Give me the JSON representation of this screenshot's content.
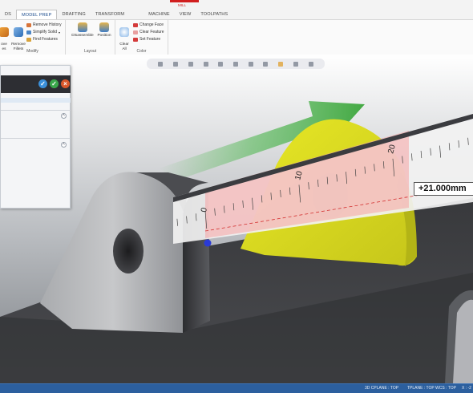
{
  "ribbon": {
    "tabs": [
      {
        "label": "DS"
      },
      {
        "label": "MODEL PREP"
      },
      {
        "label": "DRAFTING"
      },
      {
        "label": "TRANSFORM"
      },
      {
        "label": "MACHINE"
      },
      {
        "label": "VIEW"
      },
      {
        "label": "TOOLPATHS"
      }
    ],
    "context_label": "MILL",
    "groups": {
      "modify": {
        "label": "Modify",
        "move_faces": "ove\nes",
        "remove_fillets": "Remove\nFillets",
        "remove_history": "Remove History",
        "simplify_solid": "Simplify Solid",
        "find_features": "Find Features"
      },
      "layout": {
        "label": "Layout",
        "disassemble": "Disassemble",
        "position": "Position"
      },
      "color": {
        "label": "Color",
        "clear_all": "Clear\nAll",
        "change_face": "Change Face",
        "clear_feature": "Clear Feature",
        "set_feature": "Set Feature"
      }
    }
  },
  "measurement": {
    "value": "+21.000mm",
    "ruler_labels": [
      "0",
      "10",
      "20"
    ]
  },
  "status": {
    "cplane": "3D   CPLANE : TOP",
    "tplane": "TPLANE : TOP",
    "wcs": "WCS : TOP",
    "x": "X : -2"
  },
  "colors": {
    "status_bar": "#2c5f9e",
    "panel_header": "#2d2e33",
    "ok_blue": "#3b8fd9",
    "ok_green": "#3aa84b",
    "cancel_red": "#d9582b",
    "arrow_green": "#49b54a",
    "face_yellow": "#e0e21b",
    "highlight_orange": "#ef9e73"
  }
}
